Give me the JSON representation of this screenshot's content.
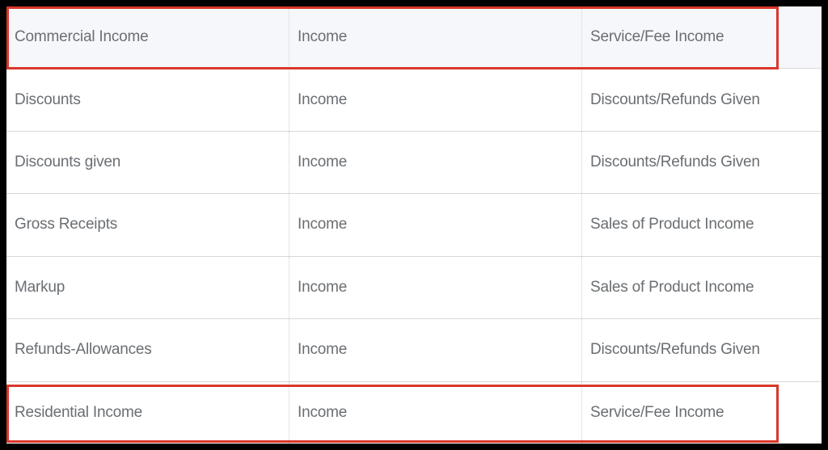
{
  "table": {
    "rows": [
      {
        "name": "Commercial Income",
        "type": "Income",
        "detail": "Service/Fee Income",
        "highlighted": true
      },
      {
        "name": "Discounts",
        "type": "Income",
        "detail": "Discounts/Refunds Given",
        "highlighted": false
      },
      {
        "name": "Discounts given",
        "type": "Income",
        "detail": "Discounts/Refunds Given",
        "highlighted": false
      },
      {
        "name": "Gross Receipts",
        "type": "Income",
        "detail": "Sales of Product Income",
        "highlighted": false
      },
      {
        "name": "Markup",
        "type": "Income",
        "detail": "Sales of Product Income",
        "highlighted": false
      },
      {
        "name": "Refunds-Allowances",
        "type": "Income",
        "detail": "Discounts/Refunds Given",
        "highlighted": false
      },
      {
        "name": "Residential Income",
        "type": "Income",
        "detail": "Service/Fee Income",
        "highlighted": false
      }
    ]
  }
}
